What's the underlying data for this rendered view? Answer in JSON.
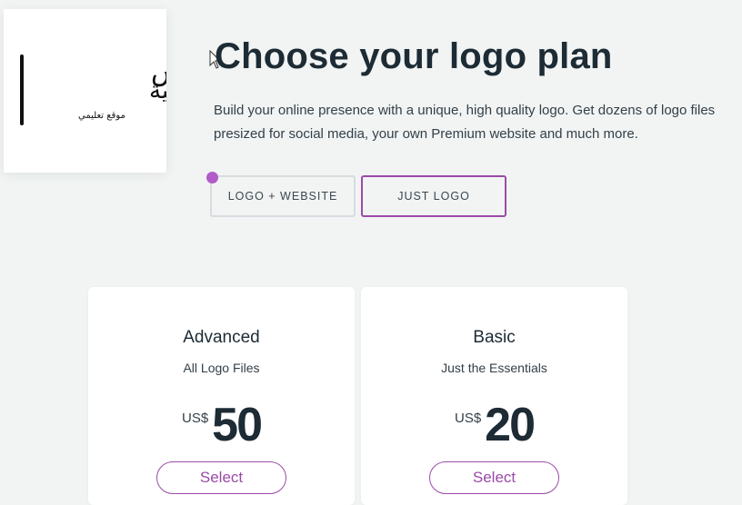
{
  "logo": {
    "line1": "ووردبريس",
    "line2": "بالعربية",
    "tagline": "موقع تعليمي"
  },
  "header": {
    "title": "Choose your logo plan",
    "description": "Build your online presence with a unique, high quality logo. Get dozens of logo files presized for social media, your own Premium website and much more."
  },
  "toggle": {
    "logo_website": "LOGO + WEBSITE",
    "just_logo": "JUST LOGO",
    "selected": "JUST LOGO"
  },
  "plans": [
    {
      "name": "Advanced",
      "subtitle": "All Logo Files",
      "currency": "US$",
      "price": "50",
      "cta": "Select"
    },
    {
      "name": "Basic",
      "subtitle": "Just the Essentials",
      "currency": "US$",
      "price": "20",
      "cta": "Select"
    }
  ],
  "colors": {
    "accent": "#9b4aa8",
    "background": "#f1f4f3",
    "text_dark": "#1d2b35"
  }
}
